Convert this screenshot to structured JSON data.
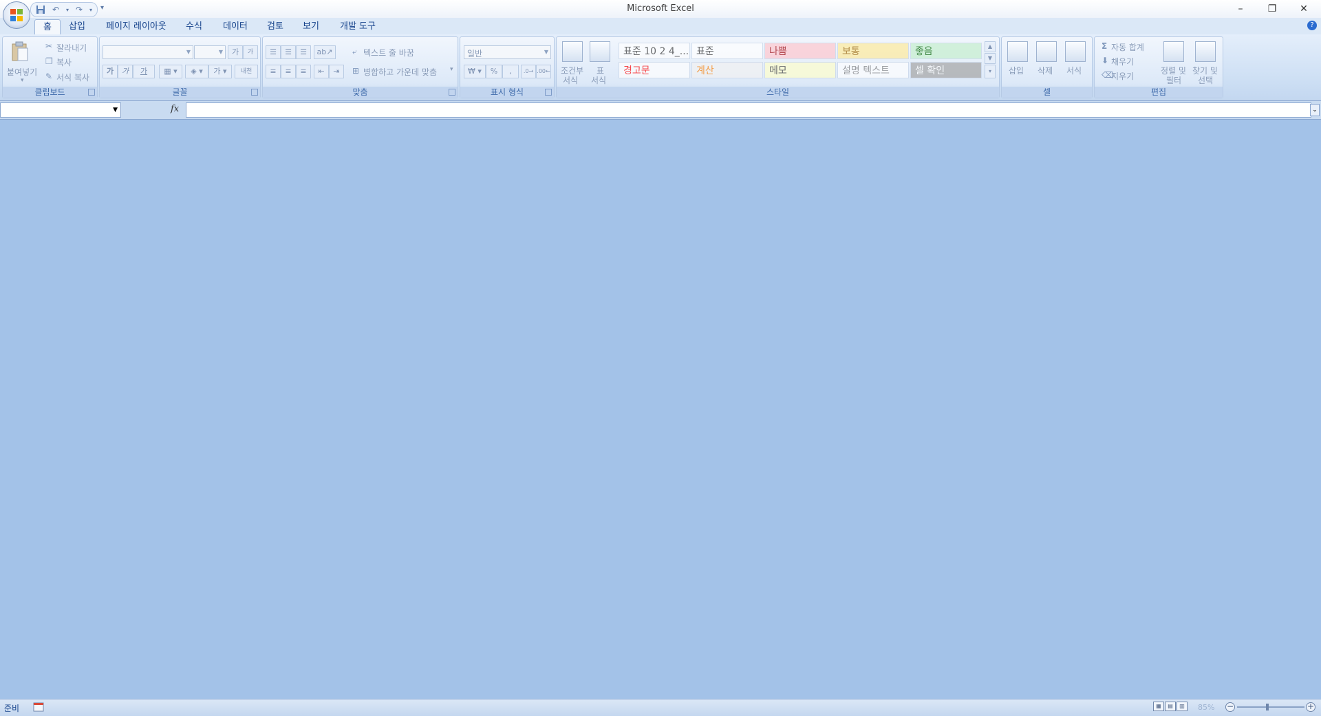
{
  "app": {
    "title": "Microsoft Excel"
  },
  "quick_access": {
    "icons": [
      "save-icon",
      "undo-icon",
      "redo-icon",
      "customize-qat-icon"
    ]
  },
  "tabs": [
    {
      "label": "홈",
      "active": true
    },
    {
      "label": "삽입"
    },
    {
      "label": "페이지 레이아웃"
    },
    {
      "label": "수식"
    },
    {
      "label": "데이터"
    },
    {
      "label": "검토"
    },
    {
      "label": "보기"
    },
    {
      "label": "개발 도구"
    }
  ],
  "ribbon": {
    "clipboard": {
      "label": "클립보드",
      "paste": "붙여넣기",
      "cut": "잘라내기",
      "copy": "복사",
      "format_painter": "서식 복사"
    },
    "font": {
      "label": "글꼴",
      "font_name": "",
      "font_size": "",
      "grow": "가",
      "shrink": "가",
      "bold": "가",
      "italic": "가",
      "underline": "가",
      "font_color": "가",
      "phonetic": "내천"
    },
    "alignment": {
      "label": "맞춤",
      "wrap_text": "텍스트 줄 바꿈",
      "merge_center": "병합하고 가운데 맞춤"
    },
    "number": {
      "label": "표시 형식",
      "format": "일반",
      "currency": "₩",
      "percent": "%",
      "comma": ","
    },
    "styles": {
      "label": "스타일",
      "conditional": "조건부\n서식",
      "conditional_l1": "조건부",
      "conditional_l2": "서식",
      "table_l1": "표",
      "table_l2": "서식",
      "cells": [
        {
          "text": "표준 10 2 4_...",
          "bg": "#ffffff",
          "color": "#333333"
        },
        {
          "text": "표준",
          "bg": "#ffffff",
          "color": "#333333"
        },
        {
          "text": "나쁨",
          "bg": "#ffc7ce",
          "color": "#9c0006"
        },
        {
          "text": "보통",
          "bg": "#ffeb9c",
          "color": "#9c6500"
        },
        {
          "text": "좋음",
          "bg": "#c6efce",
          "color": "#006100"
        },
        {
          "text": "경고문",
          "bg": "#ffffff",
          "color": "#ff0000"
        },
        {
          "text": "계산",
          "bg": "#f2f2f2",
          "color": "#fa7d00"
        },
        {
          "text": "메모",
          "bg": "#ffffcc",
          "color": "#333333"
        },
        {
          "text": "설명 텍스트",
          "bg": "#ffffff",
          "color": "#7f7f7f"
        },
        {
          "text": "셀 확인",
          "bg": "#a5a5a5",
          "color": "#ffffff"
        }
      ]
    },
    "cells": {
      "label": "셀",
      "insert": "삽입",
      "delete": "삭제",
      "format": "서식"
    },
    "editing": {
      "label": "편집",
      "autosum": "자동 합계",
      "fill": "채우기",
      "clear": "지우기",
      "sort_l1": "정렬 및",
      "sort_l2": "필터",
      "find_l1": "찾기 및",
      "find_l2": "선택"
    }
  },
  "formula_bar": {
    "name_box": "",
    "fx": "fx",
    "formula": ""
  },
  "status": {
    "text": "준비",
    "zoom": "85%",
    "zoom_fraction": 0.45
  },
  "colors": {
    "workspace": "#a3c2e8",
    "ribbon_text": "#15428b"
  }
}
